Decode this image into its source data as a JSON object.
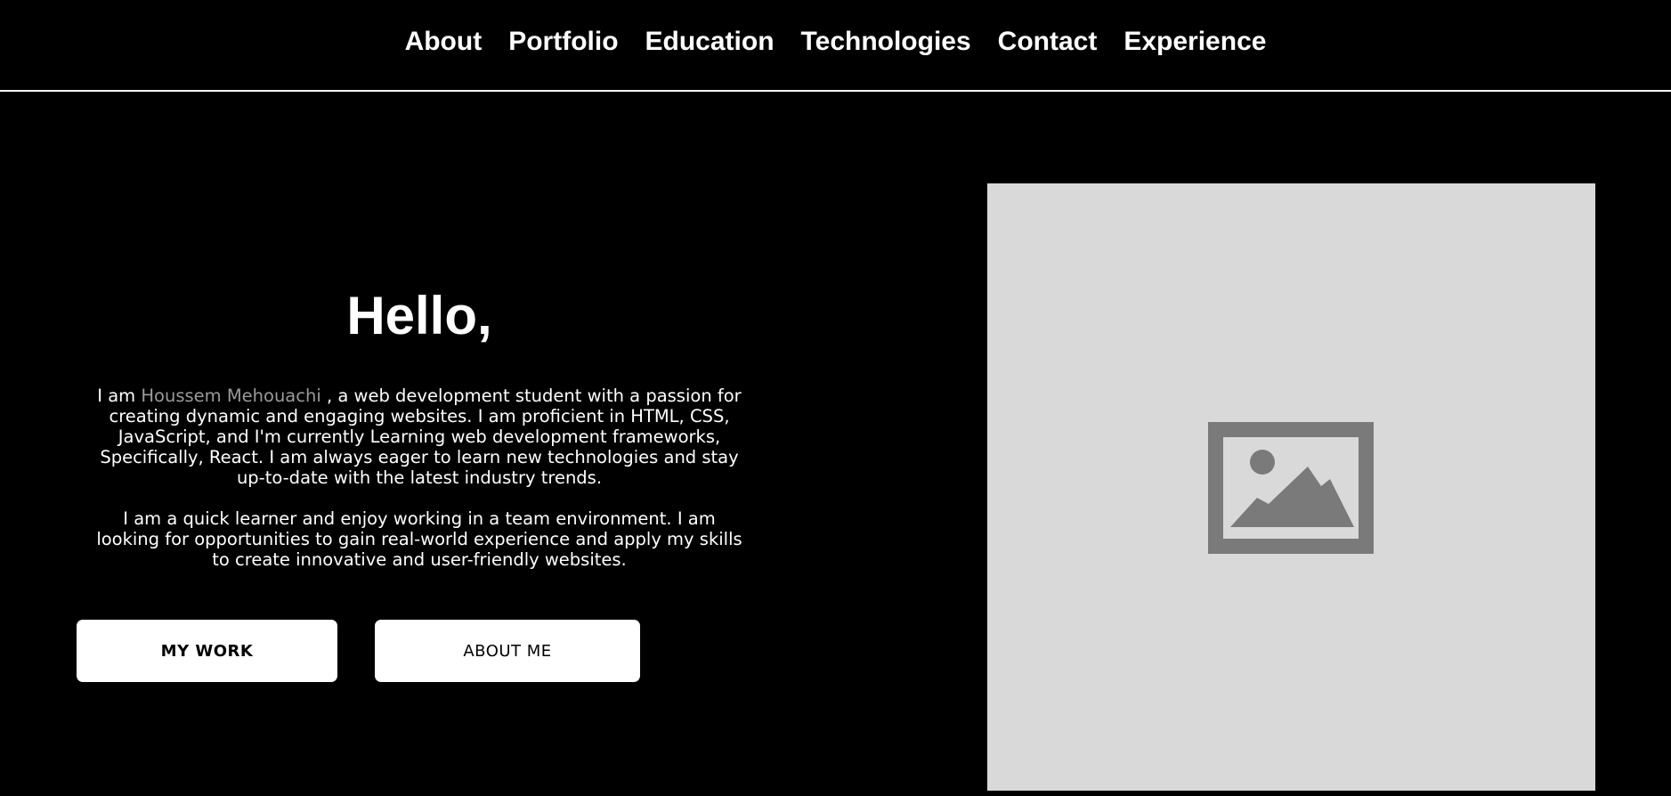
{
  "nav": {
    "items": [
      {
        "label": "About"
      },
      {
        "label": "Portfolio"
      },
      {
        "label": "Education"
      },
      {
        "label": "Technologies"
      },
      {
        "label": "Contact"
      },
      {
        "label": "Experience"
      }
    ]
  },
  "hero": {
    "greeting": "Hello,",
    "intro_prefix": "I am ",
    "name": "Houssem Mehouachi",
    "intro_rest": " , a web development student with a passion for\ncreating dynamic and engaging websites.  I am proficient in HTML, CSS,\nJavaScript, and I'm currently Learning web development   frameworks,\nSpecifically, React. I am always eager to learn new  technologies and stay\nup-to-date with the latest industry trends.",
    "intro_second": "I am  a quick learner and enjoy working in a team environment. I am\nlooking  for opportunities to gain real-world experience and apply my skills\nto  create innovative and user-friendly websites.",
    "buttons": {
      "my_work": "MY WORK",
      "about_me": "ABOUT ME"
    }
  },
  "image": {
    "icon": "image-placeholder-icon"
  },
  "colors": {
    "background": "#000000",
    "text": "#ffffff",
    "name_highlight": "#9a9a9a",
    "image_placeholder": "#d9d9d9",
    "icon": "#7a7a7a"
  }
}
